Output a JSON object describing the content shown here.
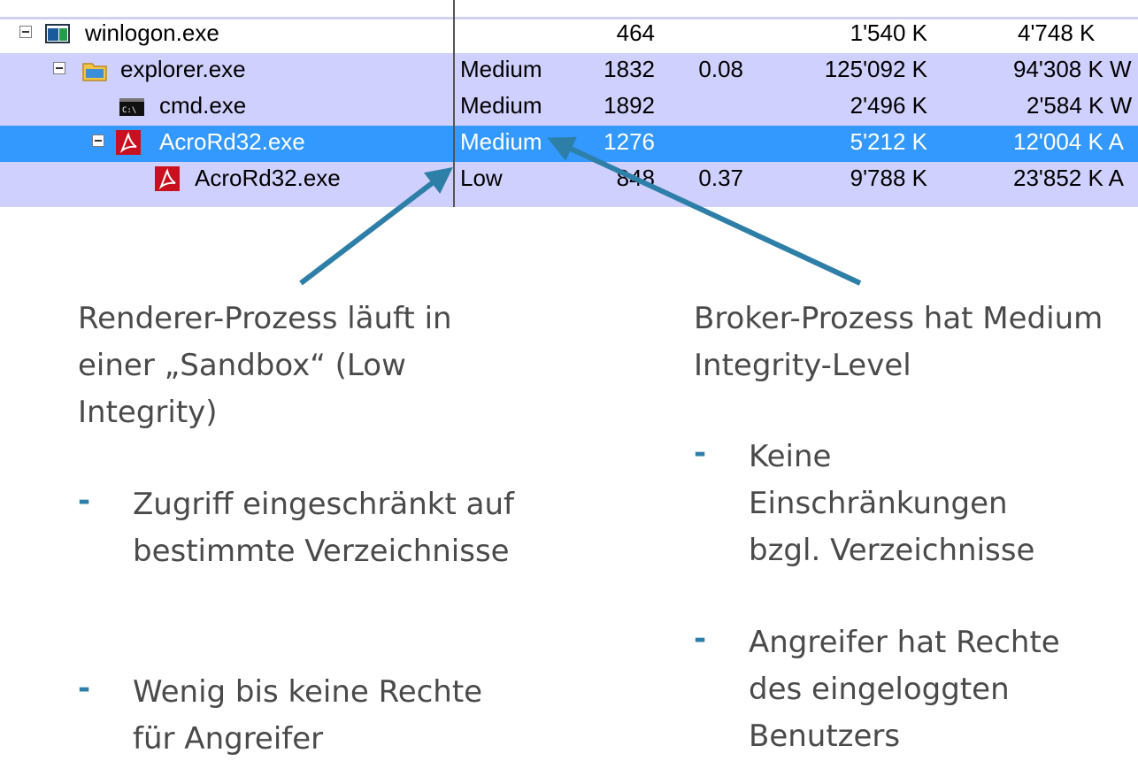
{
  "process_table": {
    "rows": [
      {
        "name": "winlogon.exe",
        "integrity": "",
        "pid": "464",
        "cpu": "",
        "private_bytes": "1'540 K",
        "working_set": "4'748 K",
        "icon": "window-icon"
      },
      {
        "name": "explorer.exe",
        "integrity": "Medium",
        "pid": "1832",
        "cpu": "0.08",
        "private_bytes": "125'092 K",
        "working_set": "94'308 K W",
        "icon": "folder-icon"
      },
      {
        "name": "cmd.exe",
        "integrity": "Medium",
        "pid": "1892",
        "cpu": "",
        "private_bytes": "2'496 K",
        "working_set": "2'584 K W",
        "icon": "console-icon"
      },
      {
        "name": "AcroRd32.exe",
        "integrity": "Medium",
        "pid": "1276",
        "cpu": "",
        "private_bytes": "5'212 K",
        "working_set": "12'004 K A",
        "icon": "pdf-icon",
        "selected": true
      },
      {
        "name": "AcroRd32.exe",
        "integrity": "Low",
        "pid": "848",
        "cpu": "0.37",
        "private_bytes": "9'788 K",
        "working_set": "23'852 K A",
        "icon": "pdf-icon"
      }
    ],
    "colors": {
      "alt_row": "#d0d0ff",
      "selected_row": "#3399ff",
      "arrow": "#2e7fa8"
    }
  },
  "annotations": {
    "left": {
      "heading": "Renderer-Prozess läuft in einer „Sandbox“ (Low Integrity)",
      "bullets": [
        "Zugriff eingeschränkt auf bestimmte Verzeichnisse",
        "Wenig bis keine Rechte für Angreifer"
      ]
    },
    "right": {
      "heading": "Broker-Prozess hat Medium Integrity-Level",
      "bullets": [
        "Keine Einschränkungen bzgl. Verzeichnisse",
        "Angreifer hat Rechte des eingeloggten Benutzers"
      ]
    },
    "bullet_marker": "-"
  }
}
